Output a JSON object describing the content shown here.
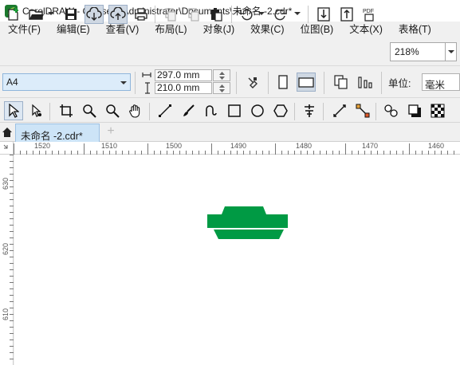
{
  "window": {
    "title": "CorelDRAW - C:\\Users\\Administrator\\Documents\\未命名 -2.cdr*"
  },
  "menu": [
    "文件(F)",
    "编辑(E)",
    "查看(V)",
    "布局(L)",
    "对象(J)",
    "效果(C)",
    "位图(B)",
    "文本(X)",
    "表格(T)"
  ],
  "toolbar": {
    "zoom": "218%"
  },
  "property_bar": {
    "page_size": "A4",
    "width": "297.0 mm",
    "height": "210.0 mm",
    "units_label": "单位:",
    "units_value": "毫米"
  },
  "tabs": [
    {
      "label": "未命名 -2.cdr*"
    }
  ],
  "rulers": {
    "horizontal_labels": [
      "1520",
      "1510",
      "1500",
      "1490",
      "1480",
      "1470",
      "1460"
    ],
    "vertical_labels": [
      "630",
      "620",
      "610"
    ]
  },
  "colors": {
    "shape_fill": "#009a44",
    "accent": "#1a8a2e",
    "selection": "#dcecfa"
  }
}
